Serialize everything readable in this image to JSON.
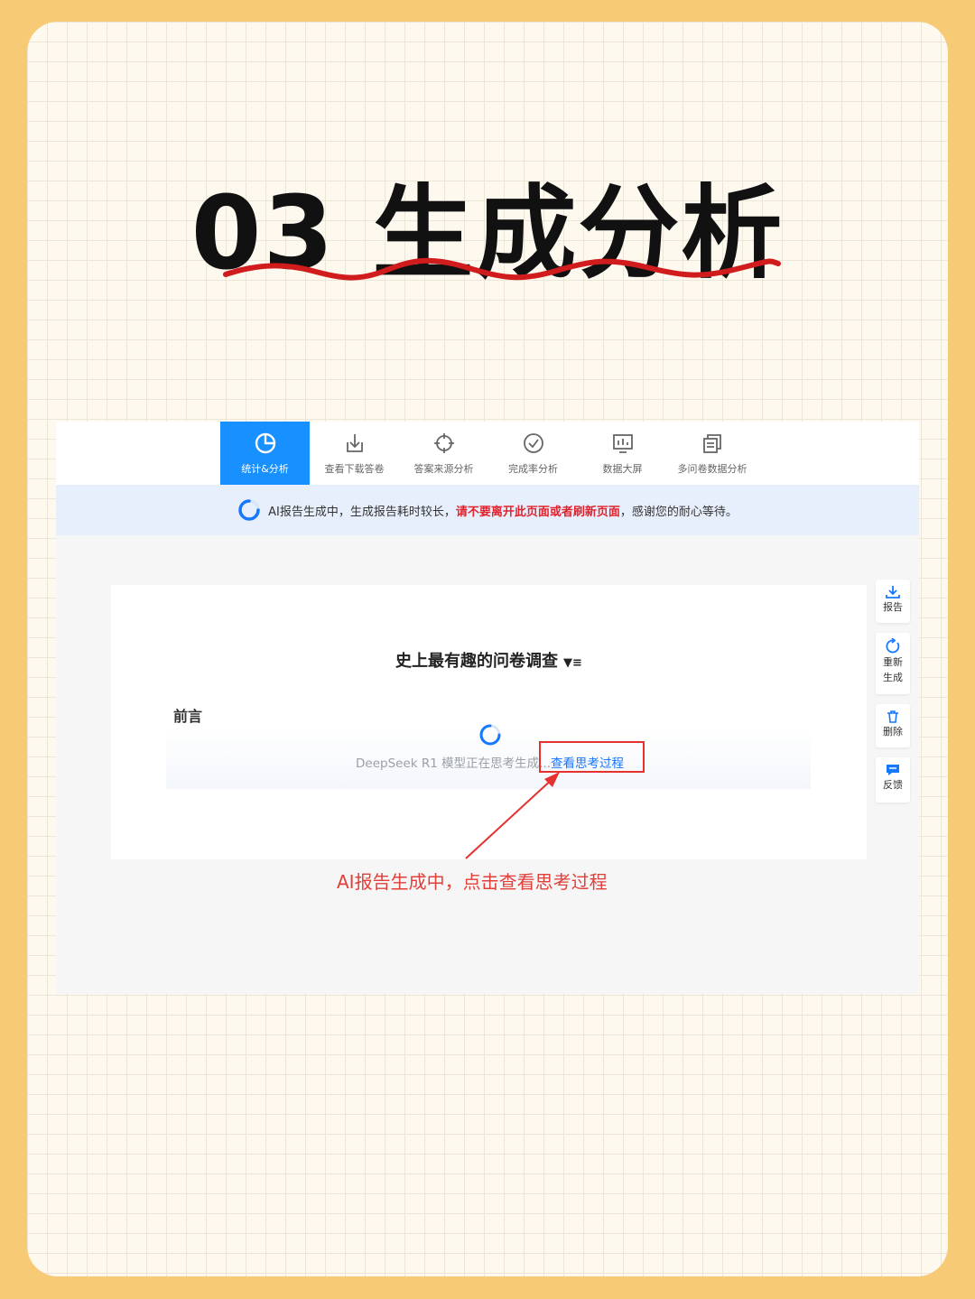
{
  "header": {
    "title": "03 生成分析"
  },
  "nav": {
    "tabs": [
      {
        "label": "统计&分析",
        "icon": "pie-chart-icon",
        "active": true
      },
      {
        "label": "查看下载答卷",
        "icon": "download-icon",
        "active": false
      },
      {
        "label": "答案来源分析",
        "icon": "crosshair-icon",
        "active": false
      },
      {
        "label": "完成率分析",
        "icon": "check-circle-icon",
        "active": false
      },
      {
        "label": "数据大屏",
        "icon": "monitor-chart-icon",
        "active": false
      },
      {
        "label": "多问卷数据分析",
        "icon": "copy-docs-icon",
        "active": false
      }
    ]
  },
  "notice": {
    "prefix": "AI报告生成中，生成报告耗时较长，",
    "warning": "请不要离开此页面或者刷新页面",
    "suffix": "，感谢您的耐心等待。"
  },
  "report": {
    "title": "史上最有趣的问卷调查",
    "section": "前言",
    "thinking_message": "DeepSeek R1 模型正在思考生成...",
    "thinking_link": "查看思考过程"
  },
  "side_actions": [
    {
      "label": "报告",
      "icon": "download-icon"
    },
    {
      "label": "重新生成",
      "icon": "refresh-icon"
    },
    {
      "label": "删除",
      "icon": "trash-icon"
    },
    {
      "label": "反馈",
      "icon": "chat-icon"
    }
  ],
  "annotation": {
    "caption": "AI报告生成中，点击查看思考过程"
  },
  "colors": {
    "accent": "#1890ff",
    "warning": "#e0242d",
    "annotation": "#e5312f",
    "background": "#f7ca75"
  }
}
